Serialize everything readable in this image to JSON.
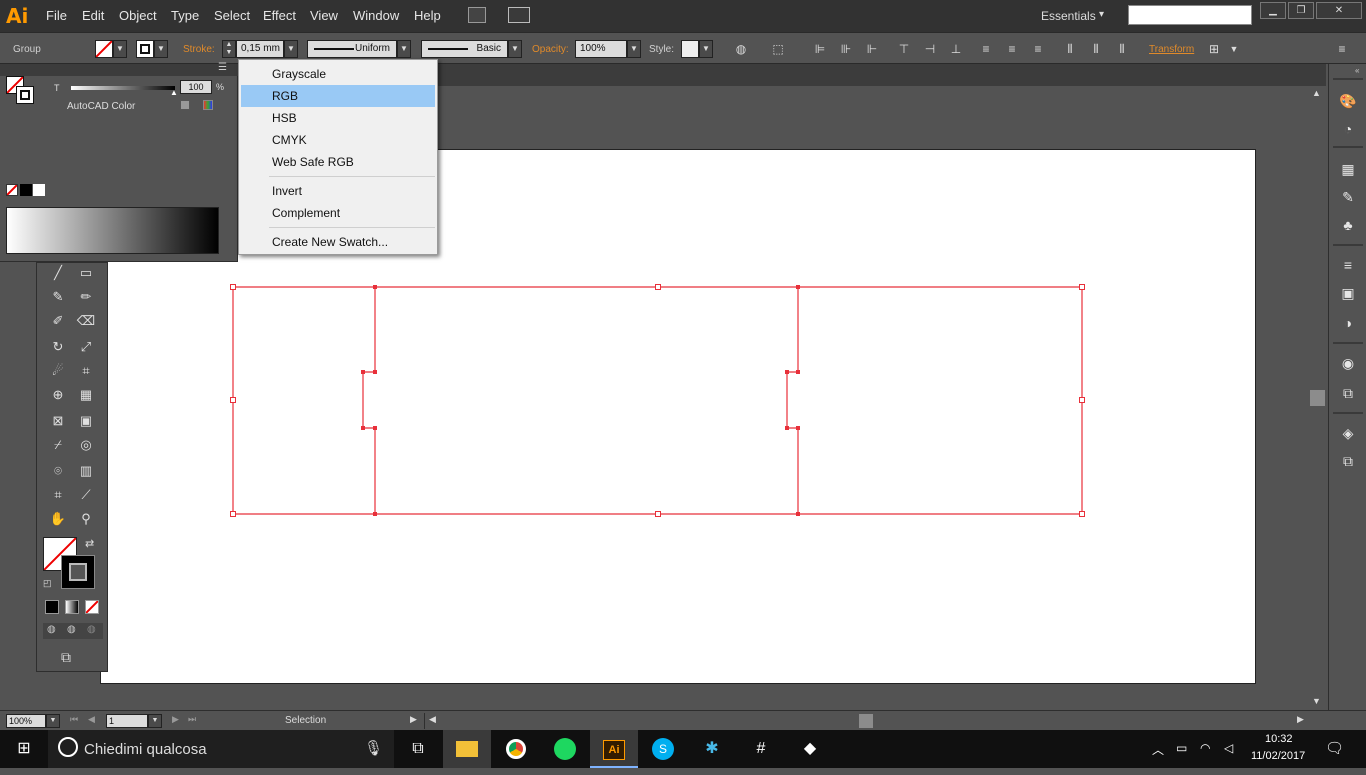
{
  "app": {
    "logo": "Ai",
    "menu": [
      "File",
      "Edit",
      "Object",
      "Type",
      "Select",
      "Effect",
      "View",
      "Window",
      "Help"
    ],
    "workspace": "Essentials",
    "workspace_arrow": "▾",
    "window_buttons": {
      "minimize": "▁",
      "restore": "❐",
      "close": "✕"
    }
  },
  "controlbar": {
    "selection_type": "Group",
    "stroke_label": "Stroke:",
    "stroke_weight": "0,15 mm",
    "profile": "Uniform",
    "brush": "Basic",
    "opacity_label": "Opacity:",
    "opacity_value": "100%",
    "style_label": "Style:",
    "transform_label": "Transform"
  },
  "colorpanel": {
    "channel_label": "T",
    "value": "100",
    "unit": "%",
    "color_name": "AutoCAD Color"
  },
  "flyout": {
    "items": [
      "Grayscale",
      "RGB",
      "HSB",
      "CMYK",
      "Web Safe RGB"
    ],
    "items2": [
      "Invert",
      "Complement"
    ],
    "items3": [
      "Create New Swatch..."
    ],
    "selected": "RGB"
  },
  "statusbar": {
    "zoom": "100%",
    "artboard": "1",
    "tool": "Selection"
  },
  "taskbar": {
    "search_placeholder": "Chiedimi qualcosa",
    "time": "10:32",
    "date": "11/02/2017"
  },
  "colors": {
    "accent_orange": "#ff9a00",
    "selection_red": "#e8303a",
    "menu_highlight": "#99c9f5"
  }
}
